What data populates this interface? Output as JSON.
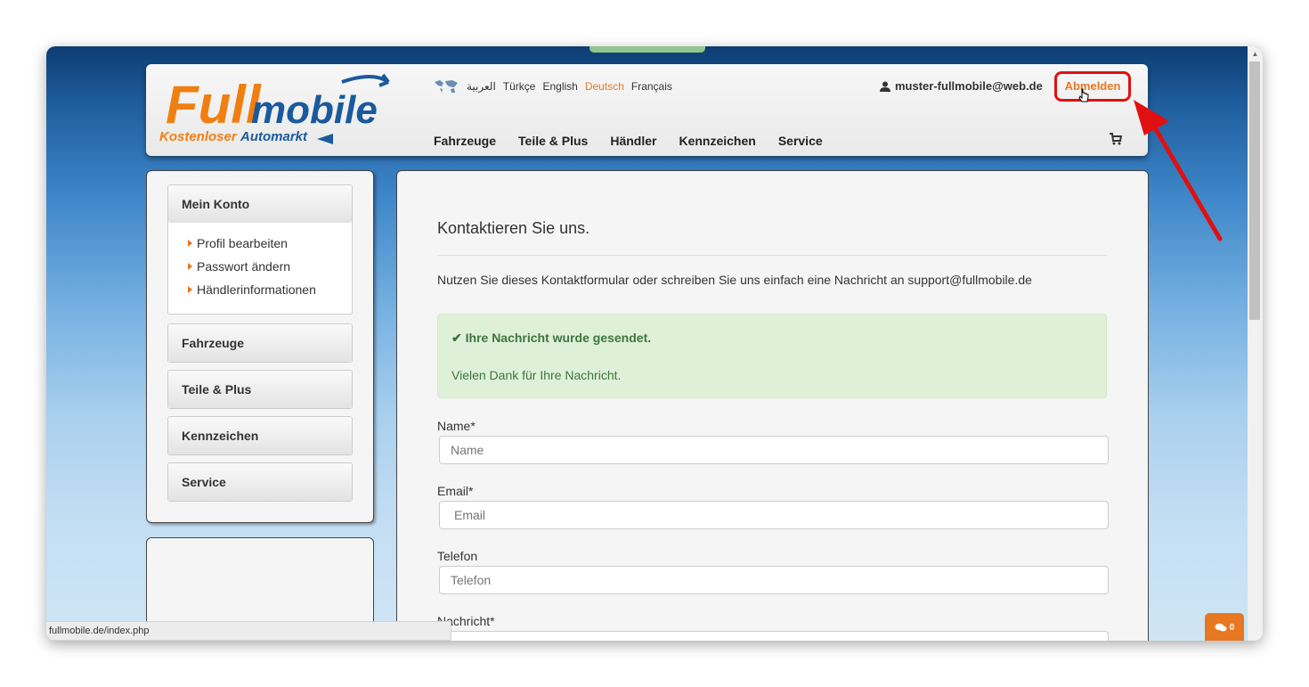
{
  "header": {
    "logo_text_main": "Fullmobile",
    "logo_tagline": "KostenloserAutomarkt",
    "languages": [
      {
        "label": "العربية",
        "active": false
      },
      {
        "label": "Türkçe",
        "active": false
      },
      {
        "label": "English",
        "active": false
      },
      {
        "label": "Deutsch",
        "active": true
      },
      {
        "label": "Français",
        "active": false
      }
    ],
    "user_email": "muster-fullmobile@web.de",
    "logout_label": "Abmelden",
    "nav": [
      "Fahrzeuge",
      "Teile & Plus",
      "Händler",
      "Kennzeichen",
      "Service"
    ]
  },
  "sidebar": {
    "account_title": "Mein Konto",
    "account_links": [
      "Profil bearbeiten",
      "Passwort ändern",
      "Händlerinformationen"
    ],
    "sections": [
      "Fahrzeuge",
      "Teile & Plus",
      "Kennzeichen",
      "Service"
    ]
  },
  "content": {
    "title": "Kontaktieren Sie uns.",
    "intro": "Nutzen Sie dieses Kontaktformular oder schreiben Sie uns einfach eine Nachricht an support@fullmobile.de",
    "alert_title": "Ihre Nachricht wurde gesendet.",
    "alert_message": "Vielen Dank für Ihre Nachricht.",
    "fields": {
      "name_label": "Name*",
      "name_placeholder": "Name",
      "email_label": "Email*",
      "email_placeholder": "Email",
      "phone_label": "Telefon",
      "phone_placeholder": "Telefon",
      "message_label": "Nachricht*"
    }
  },
  "status_bar": {
    "url": "fullmobile.de/index.php"
  },
  "chat": {
    "count": "0"
  },
  "colors": {
    "accent": "#e87722",
    "success_bg": "#dff0d8",
    "success_text": "#3c763d",
    "annotation": "#e01010"
  }
}
